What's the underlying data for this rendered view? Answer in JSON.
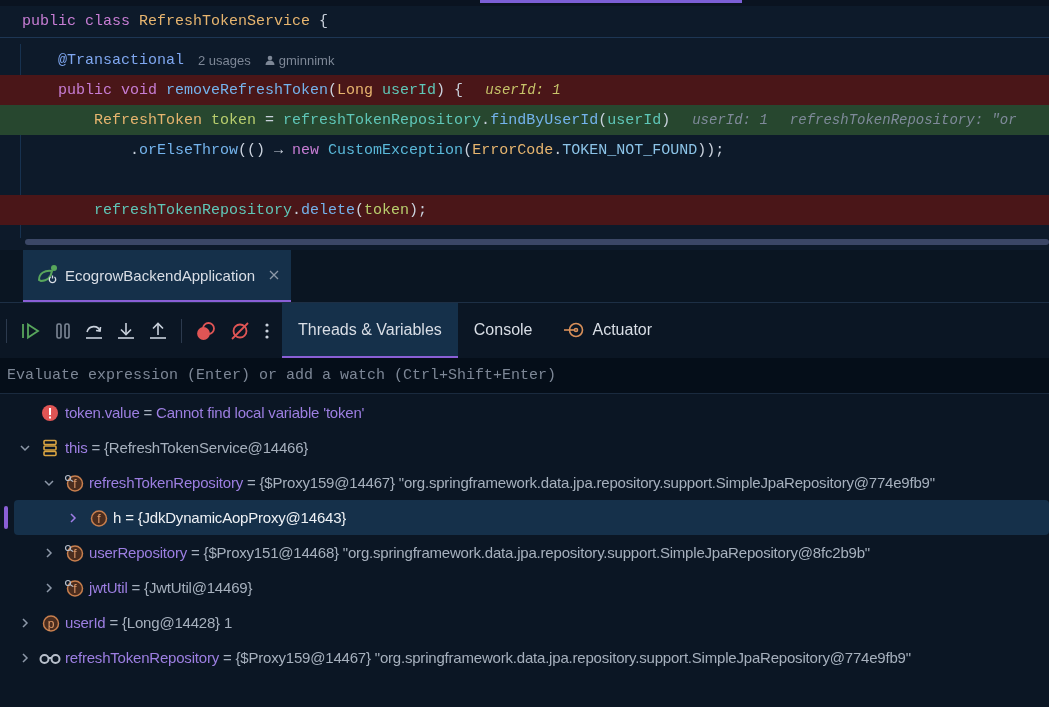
{
  "editor": {
    "lines": [
      {
        "breakpoint": false,
        "execution": false,
        "tokens": [
          {
            "text": "public class ",
            "kind": "keyword"
          },
          {
            "text": "RefreshTokenService",
            "kind": "type"
          },
          {
            "text": " {",
            "kind": "plain"
          }
        ]
      },
      {
        "breakpoint": false,
        "execution": false,
        "tokens": [
          {
            "text": "    @Transactional",
            "kind": "annotation"
          }
        ],
        "usages": "2 usages",
        "author": "gminnimk"
      },
      {
        "breakpoint": true,
        "execution": false,
        "tokens": [
          {
            "text": "    public void ",
            "kind": "keyword"
          },
          {
            "text": "removeRefreshToken",
            "kind": "method"
          },
          {
            "text": "(",
            "kind": "plain"
          },
          {
            "text": "Long ",
            "kind": "type"
          },
          {
            "text": "userId",
            "kind": "variable"
          },
          {
            "text": ") {",
            "kind": "plain"
          }
        ],
        "hints": [
          {
            "text": "userId: 1",
            "kind": "value"
          }
        ]
      },
      {
        "breakpoint": false,
        "execution": true,
        "tokens": [
          {
            "text": "        RefreshToken ",
            "kind": "type"
          },
          {
            "text": "token",
            "kind": "local"
          },
          {
            "text": " = ",
            "kind": "plain"
          },
          {
            "text": "refreshTokenRepository",
            "kind": "variable"
          },
          {
            "text": ".",
            "kind": "plain"
          },
          {
            "text": "findByUserId",
            "kind": "method"
          },
          {
            "text": "(",
            "kind": "plain"
          },
          {
            "text": "userId",
            "kind": "variable"
          },
          {
            "text": ")",
            "kind": "plain"
          }
        ],
        "hints": [
          {
            "text": "userId: 1",
            "kind": "muted"
          },
          {
            "text": "refreshTokenRepository: \"or",
            "kind": "muted"
          }
        ]
      },
      {
        "breakpoint": false,
        "execution": false,
        "tokens": [
          {
            "text": "            .",
            "kind": "plain"
          },
          {
            "text": "orElseThrow",
            "kind": "method"
          },
          {
            "text": "(() → ",
            "kind": "plain"
          },
          {
            "text": "new ",
            "kind": "keyword"
          },
          {
            "text": "CustomException",
            "kind": "class"
          },
          {
            "text": "(",
            "kind": "plain"
          },
          {
            "text": "ErrorCode",
            "kind": "type"
          },
          {
            "text": ".",
            "kind": "plain"
          },
          {
            "text": "TOKEN_NOT_FOUND",
            "kind": "constant"
          },
          {
            "text": "));",
            "kind": "plain"
          }
        ]
      },
      {
        "breakpoint": false,
        "execution": false
      },
      {
        "breakpoint": true,
        "execution": false,
        "tokens": [
          {
            "text": "        refreshTokenRepository",
            "kind": "variable"
          },
          {
            "text": ".",
            "kind": "plain"
          },
          {
            "text": "delete",
            "kind": "method"
          },
          {
            "text": "(",
            "kind": "plain"
          },
          {
            "text": "token",
            "kind": "local"
          },
          {
            "text": ");",
            "kind": "plain"
          }
        ]
      }
    ]
  },
  "debug": {
    "session_tab": {
      "label": "EcogrowBackendApplication",
      "selected": true
    },
    "tabs": [
      {
        "label": "Threads & Variables",
        "selected": true,
        "kind": "text"
      },
      {
        "label": "Console",
        "selected": false,
        "kind": "text"
      },
      {
        "label": "Actuator",
        "selected": false,
        "kind": "actuator"
      }
    ],
    "evaluate": {
      "placeholder": "Evaluate expression (Enter) or add a watch (Ctrl+Shift+Enter)"
    },
    "variables": [
      {
        "kind": "error",
        "name": "token.value",
        "operator": "=",
        "value": "Cannot find local variable 'token'",
        "selected": false
      },
      {
        "kind": "object",
        "name": "this",
        "operator": "=",
        "value": "{RefreshTokenService@14466}",
        "expanded": true,
        "selected": false,
        "children": [
          {
            "kind": "private_field",
            "icon_label": "f",
            "name": "refreshTokenRepository",
            "operator": "=",
            "value": "{$Proxy159@14467} \"org.springframework.data.jpa.repository.support.SimpleJpaRepository@774e9fb9\"",
            "expanded": true,
            "selected": false,
            "children": [
              {
                "kind": "field",
                "icon_label": "f",
                "name": "h",
                "operator": "=",
                "value": "{JdkDynamicAopProxy@14643}",
                "expanded": false,
                "selected": true
              }
            ]
          },
          {
            "kind": "private_field",
            "icon_label": "f",
            "name": "userRepository",
            "operator": "=",
            "value": "{$Proxy151@14468} \"org.springframework.data.jpa.repository.support.SimpleJpaRepository@8fc2b9b\"",
            "expanded": false,
            "selected": false
          },
          {
            "kind": "private_field",
            "icon_label": "f",
            "name": "jwtUtil",
            "operator": "=",
            "value": "{JwtUtil@14469}",
            "expanded": false,
            "selected": false
          }
        ]
      },
      {
        "kind": "parameter",
        "icon_label": "p",
        "name": "userId",
        "operator": "=",
        "value": "{Long@14428} 1",
        "expanded": false,
        "selected": false
      },
      {
        "kind": "watch",
        "name": "refreshTokenRepository",
        "operator": "=",
        "value": "{$Proxy159@14467} \"org.springframework.data.jpa.repository.support.SimpleJpaRepository@774e9fb9\"",
        "expanded": false,
        "selected": false
      }
    ]
  }
}
